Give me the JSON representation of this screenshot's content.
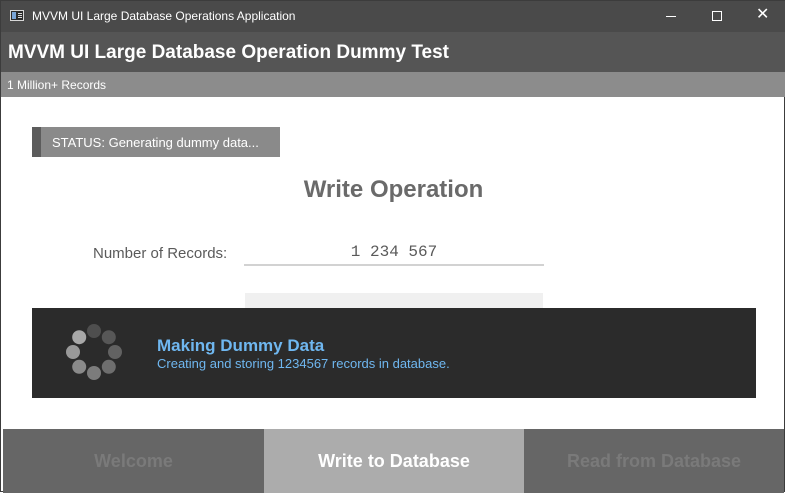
{
  "window": {
    "title": "MVVM UI Large Database Operations Application",
    "close_glyph": "✕"
  },
  "header": {
    "title": "MVVM UI Large Database Operation Dummy Test",
    "subtitle": "1 Million+ Records"
  },
  "status": {
    "text": "STATUS: Generating dummy data..."
  },
  "operation": {
    "title": "Write Operation",
    "records_label": "Number of Records:",
    "records_value": "1 234 567"
  },
  "overlay": {
    "title": "Making Dummy Data",
    "subtitle": "Creating and storing 1234567 records in database.",
    "icon": "loading-spinner-icon"
  },
  "nav": {
    "welcome": "Welcome",
    "write": "Write to Database",
    "read": "Read from Database"
  },
  "colors": {
    "titlebar": "#4a4a4a",
    "header": "#555555",
    "subheader": "#8c8c8c",
    "overlay": "#2b2b2b",
    "accent": "#6fb7f0",
    "active_nav": "#acacac"
  }
}
